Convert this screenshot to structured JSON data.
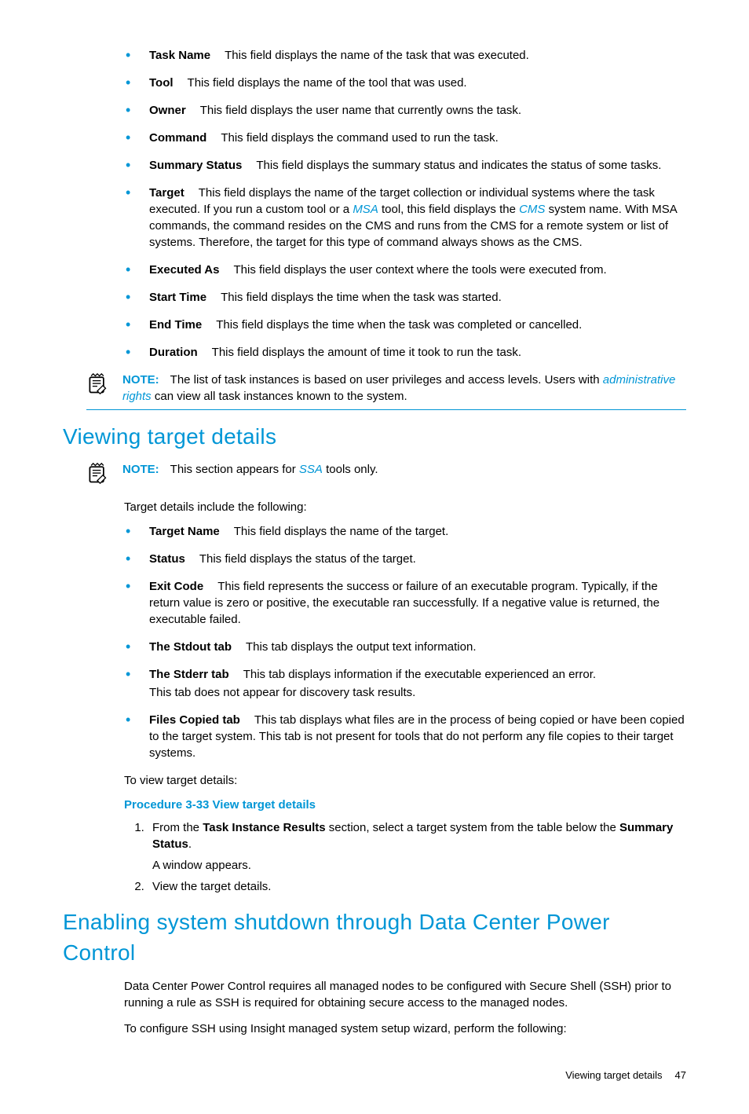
{
  "list1": [
    {
      "label": "Task Name",
      "text": "This field displays the name of the task that was executed."
    },
    {
      "label": "Tool",
      "text": "This field displays the name of the tool that was used."
    },
    {
      "label": "Owner",
      "text": "This field displays the user name that currently owns the task."
    },
    {
      "label": "Command",
      "text": "This field displays the command used to run the task."
    },
    {
      "label": "Summary Status",
      "text": "This field displays the summary status and indicates the status of some tasks."
    }
  ],
  "target_item": {
    "label": "Target",
    "pre": "This field displays the name of the target collection or individual systems where the task executed. If you run a custom tool or a ",
    "link1": "MSA",
    "mid": " tool, this field displays the ",
    "link2": "CMS",
    "post": " system name. With MSA commands, the command resides on the CMS and runs from the CMS for a remote system or list of systems. Therefore, the target for this type of command always shows as the CMS."
  },
  "list1b": [
    {
      "label": "Executed As",
      "text": "This field displays the user context where the tools were executed from."
    },
    {
      "label": "Start Time",
      "text": "This field displays the time when the task was started."
    },
    {
      "label": "End Time",
      "text": "This field displays the time when the task was completed or cancelled."
    },
    {
      "label": "Duration",
      "text": "This field displays the amount of time it took to run the task."
    }
  ],
  "note1": {
    "label": "NOTE:",
    "pre": "The list of task instances is based on user privileges and access levels. Users with ",
    "link": "administrative rights",
    "post": " can view all task instances known to the system."
  },
  "heading1": "Viewing target details",
  "note2": {
    "label": "NOTE:",
    "pre": "This section appears for ",
    "link": "SSA",
    "post": " tools only."
  },
  "intro2": "Target details include the following:",
  "list2": [
    {
      "label": "Target Name",
      "text": "This field displays the name of the target."
    },
    {
      "label": "Status",
      "text": "This field displays the status of the target."
    },
    {
      "label": "Exit Code",
      "text": "This field represents the success or failure of an executable program. Typically, if the return value is zero or positive, the executable ran successfully. If a negative value is returned, the executable failed."
    },
    {
      "label": "The Stdout tab",
      "text": "This tab displays the output text information."
    }
  ],
  "stderr_item": {
    "label": "The Stderr tab",
    "text": "This tab displays information if the executable experienced an error.",
    "sub": "This tab does not appear for discovery task results."
  },
  "files_item": {
    "label": "Files Copied tab",
    "text": "This tab displays what files are in the process of being copied or have been copied to the target system. This tab is not present for tools that do not perform any file copies to their target systems."
  },
  "para_view": "To view target details:",
  "procedure_title": "Procedure 3-33 View target details",
  "step1": {
    "pre": "From the ",
    "b1": "Task Instance Results",
    "mid": " section, select a target system from the table below the ",
    "b2": "Summary Status",
    "post": ".",
    "sub": "A window appears."
  },
  "step2": "View the target details.",
  "heading2": "Enabling system shutdown through Data Center Power Control",
  "para_dcpc1": "Data Center Power Control requires all managed nodes to be configured with Secure Shell (SSH) prior to running a rule as SSH is required for obtaining secure access to the managed nodes.",
  "para_dcpc2": "To configure SSH using Insight managed system setup wizard, perform the following:",
  "footer": {
    "text": "Viewing target details",
    "page": "47"
  }
}
